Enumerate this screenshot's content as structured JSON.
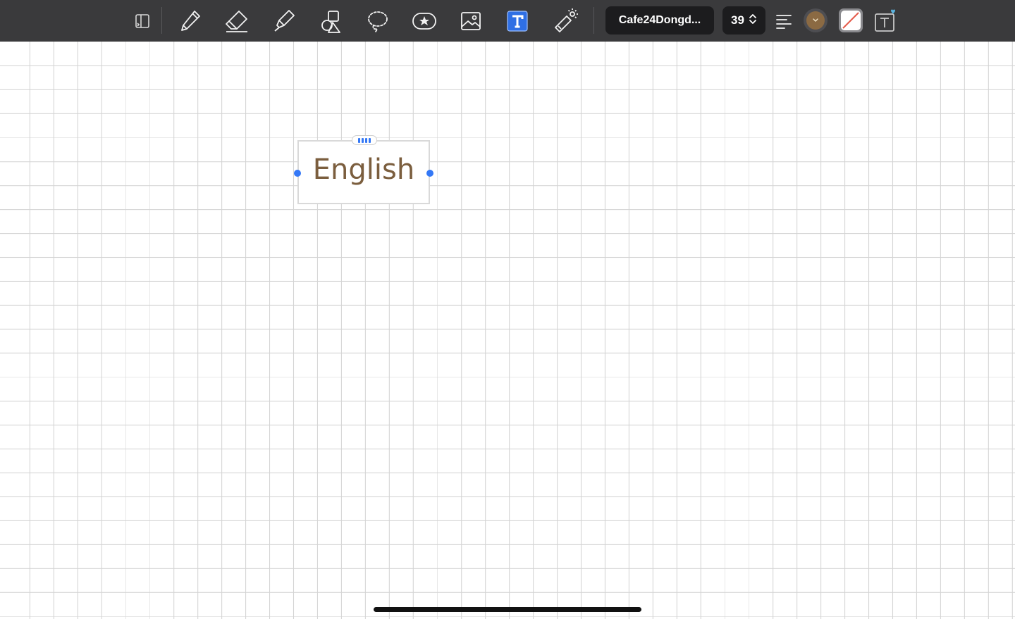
{
  "toolbar": {
    "tools": [
      {
        "name": "page-layout-icon"
      },
      {
        "name": "pen-icon"
      },
      {
        "name": "eraser-icon"
      },
      {
        "name": "highlighter-icon"
      },
      {
        "name": "shapes-icon"
      },
      {
        "name": "lasso-icon"
      },
      {
        "name": "sticker-icon"
      },
      {
        "name": "image-icon"
      },
      {
        "name": "text-tool-icon",
        "active": true
      },
      {
        "name": "laser-pointer-icon"
      }
    ],
    "font_name": "Cafe24Dongd...",
    "font_size": "39",
    "alignment_icon": "align-left-icon",
    "text_color": "#8b6a43",
    "background_swatch_icon": "no-fill-icon",
    "text_style_icon": "text-style-icon",
    "accent_color": "#3478f6"
  },
  "canvas": {
    "text_box": {
      "text": "English",
      "text_color": "#7b5e3e"
    }
  }
}
